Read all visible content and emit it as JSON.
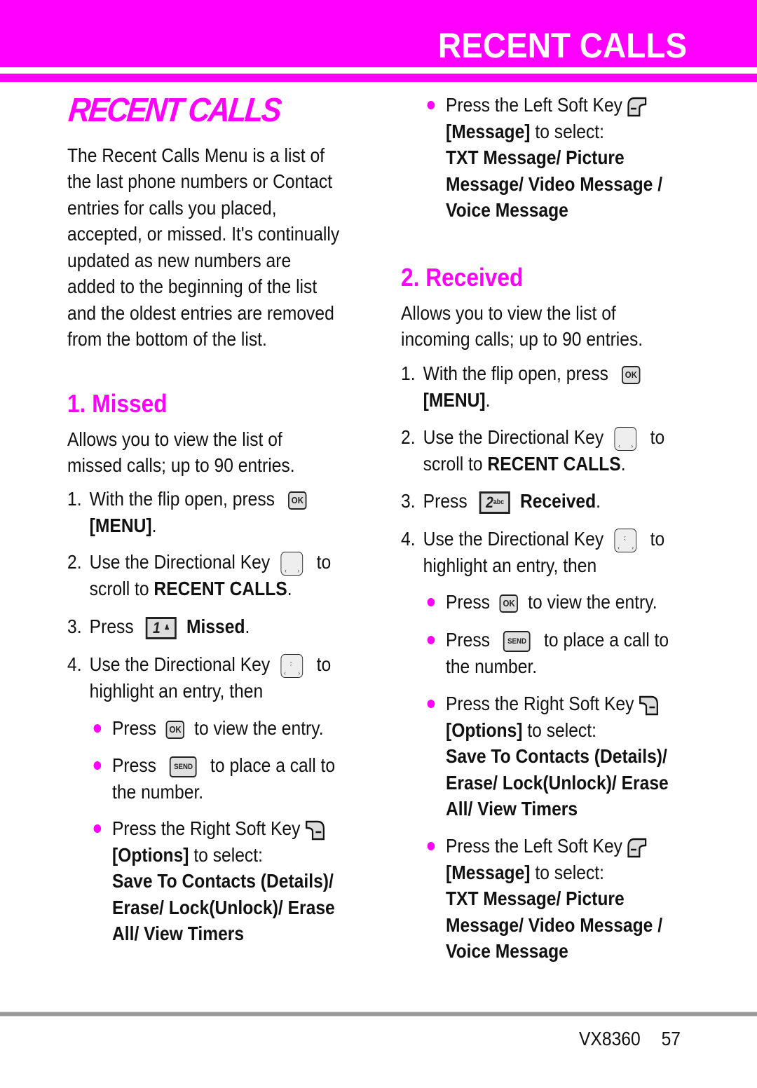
{
  "header": {
    "title": "RECENT CALLS"
  },
  "page_title": "RECENT CALLS",
  "intro": [
    "The Recent Calls Menu is a list of",
    "the last phone numbers or Contact",
    "entries for calls you placed,",
    "accepted, or missed. It's continually",
    "updated as new numbers are",
    "added to the beginning of the list",
    "and the oldest entries are removed",
    "from the bottom of the list."
  ],
  "sections": [
    {
      "title": "1. Missed",
      "desc": [
        "Allows you to view the list of",
        "missed calls; up to 90 entries."
      ],
      "step1": {
        "num": "1.",
        "text": "With the flip open, press",
        "bold": "[MENU]",
        "tail": "."
      },
      "step2": {
        "num": "2.",
        "text": "Use the Directional Key",
        "to": "to",
        "line2": "scroll to ",
        "bold": "RECENT CALLS",
        "tail": "."
      },
      "step3": {
        "num": "3.",
        "text": "Press",
        "key_digit": "1",
        "bold": "Missed",
        "tail": "."
      },
      "step4": {
        "num": "4.",
        "text": "Use the Directional Key",
        "to": "to",
        "line2": "highlight an entry, then"
      },
      "bullets": {
        "view": {
          "press": "Press",
          "rest": "to view the entry."
        },
        "call": {
          "press": "Press",
          "rest": "to place a call to",
          "line2": "the number."
        },
        "options": {
          "text": "Press the Right Soft Key",
          "bold": "[Options]",
          "rest": " to select:",
          "items": [
            "Save To Contacts (Details)/",
            "Erase/ Lock(Unlock)/ Erase",
            "All/ View Timers"
          ]
        }
      }
    },
    {
      "title": "2. Received",
      "desc": [
        "Allows you to view the list of",
        "incoming calls; up to 90 entries."
      ],
      "step1": {
        "num": "1.",
        "text": "With the flip open, press",
        "bold": "[MENU]",
        "tail": "."
      },
      "step2": {
        "num": "2.",
        "text": "Use the Directional Key",
        "to": "to",
        "line2": "scroll to ",
        "bold": "RECENT CALLS",
        "tail": "."
      },
      "step3": {
        "num": "3.",
        "text": "Press",
        "key_digit": "2",
        "key_letters": "abc",
        "bold": "Received",
        "tail": "."
      },
      "step4": {
        "num": "4.",
        "text": "Use the Directional Key",
        "to": "to",
        "line2": "highlight an entry, then"
      },
      "bullets": {
        "view": {
          "press": "Press",
          "rest": "to view the entry."
        },
        "call": {
          "press": "Press",
          "rest": "to place a call to",
          "line2": "the number."
        },
        "options": {
          "text": "Press the Right Soft Key",
          "bold": "[Options]",
          "rest": " to select:",
          "items": [
            "Save To Contacts (Details)/",
            "Erase/ Lock(Unlock)/ Erase",
            "All/ View Timers"
          ]
        },
        "message": {
          "text": "Press the Left Soft Key",
          "bold": "[Message]",
          "rest": " to select:",
          "items": [
            "TXT Message/ Picture",
            "Message/ Video Message /",
            "Voice Message"
          ]
        }
      }
    }
  ],
  "top_right_bullet": {
    "text": "Press the Left Soft Key",
    "bold": "[Message]",
    "rest": " to select:",
    "items": [
      "TXT Message/ Picture",
      "Message/ Video Message /",
      "Voice Message"
    ]
  },
  "keys": {
    "ok": "OK",
    "send": "SEND"
  },
  "colors": {
    "accent": "#ff00ff",
    "rule": "#999999"
  },
  "footer": {
    "model": "VX8360",
    "page": "57"
  }
}
